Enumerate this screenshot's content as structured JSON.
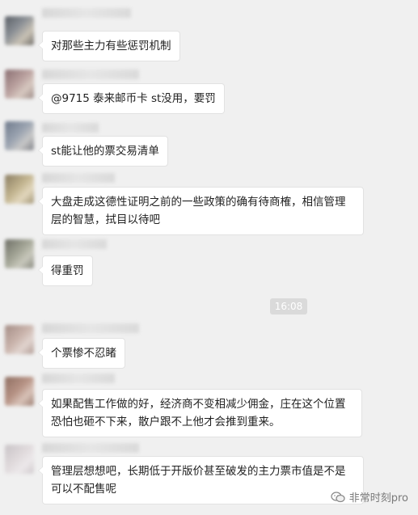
{
  "messages": [
    {
      "text": "对那些主力有些惩罚机制"
    },
    {
      "text": "@9715 泰来邮币卡 st没用，要罚"
    },
    {
      "text": "st能让他的票交易清单"
    },
    {
      "text": "大盘走成这德性证明之前的一些政策的确有待商榷，相信管理层的智慧，拭目以待吧"
    },
    {
      "text": "得重罚"
    },
    {
      "text": "个票惨不忍睹"
    },
    {
      "text": "如果配售工作做的好，经济商不变相减少佣金，庄在这个位置恐怕也砸不下来，散户跟不上他才会推到重来。"
    },
    {
      "text": "管理层想想吧，长期低于开版价甚至破发的主力票市值是不是可以不配售呢"
    }
  ],
  "timestamp": "16:08",
  "watermark": {
    "text": "非常时刻pro",
    "icon": "wechat-official-account-icon"
  },
  "colors": {
    "background": "#f0f0f0",
    "bubble": "#ffffff",
    "time_badge": "#dadada"
  }
}
